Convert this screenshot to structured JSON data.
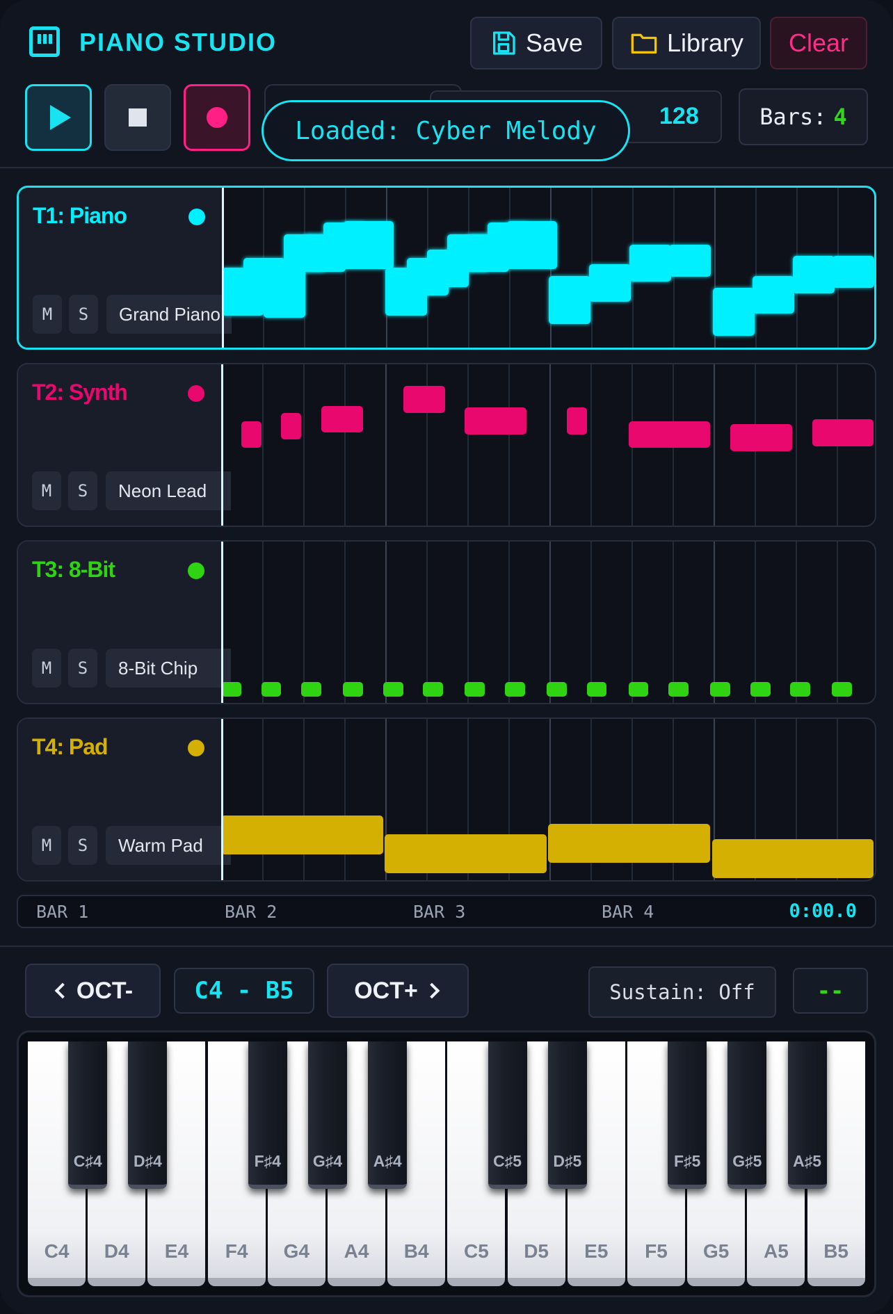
{
  "header": {
    "title": "PIANO STUDIO",
    "save_label": "Save",
    "library_label": "Library",
    "clear_label": "Clear"
  },
  "transport": {
    "bpm": "128",
    "bars_label": "Bars:",
    "bars_value": "4",
    "toast": "Loaded: Cyber Melody"
  },
  "tracks": [
    {
      "name": "T1: Piano",
      "mute": "M",
      "solo": "S",
      "instrument": "Grand Piano",
      "color": "#00f0ff",
      "selected": true
    },
    {
      "name": "T2: Synth",
      "mute": "M",
      "solo": "S",
      "instrument": "Neon Lead",
      "color": "#e8086e",
      "selected": false
    },
    {
      "name": "T3: 8-Bit",
      "mute": "M",
      "solo": "S",
      "instrument": "8-Bit Chip",
      "color": "#2fd312",
      "selected": false
    },
    {
      "name": "T4: Pad",
      "mute": "M",
      "solo": "S",
      "instrument": "Warm Pad",
      "color": "#d3b002",
      "selected": false
    }
  ],
  "timeline": {
    "bars": [
      "BAR 1",
      "BAR 2",
      "BAR 3",
      "BAR 4"
    ],
    "time": "0:00.0"
  },
  "keyboard_controls": {
    "oct_down": "OCT-",
    "range": "C4 - B5",
    "oct_up": "OCT+",
    "sustain": "Sustain: Off",
    "current_note": "--"
  },
  "keys": {
    "white": [
      "C4",
      "D4",
      "E4",
      "F4",
      "G4",
      "A4",
      "B4",
      "C5",
      "D5",
      "E5",
      "F5",
      "G5",
      "A5",
      "B5"
    ],
    "black": [
      "C♯4",
      "D♯4",
      "F♯4",
      "G♯4",
      "A♯4",
      "C♯5",
      "D♯5",
      "F♯5",
      "G♯5",
      "A♯5"
    ]
  },
  "icons": {
    "logo": "piano-icon",
    "save": "floppy-disk-icon",
    "library": "folder-icon",
    "play": "play-icon",
    "stop": "stop-icon",
    "record": "record-icon"
  }
}
